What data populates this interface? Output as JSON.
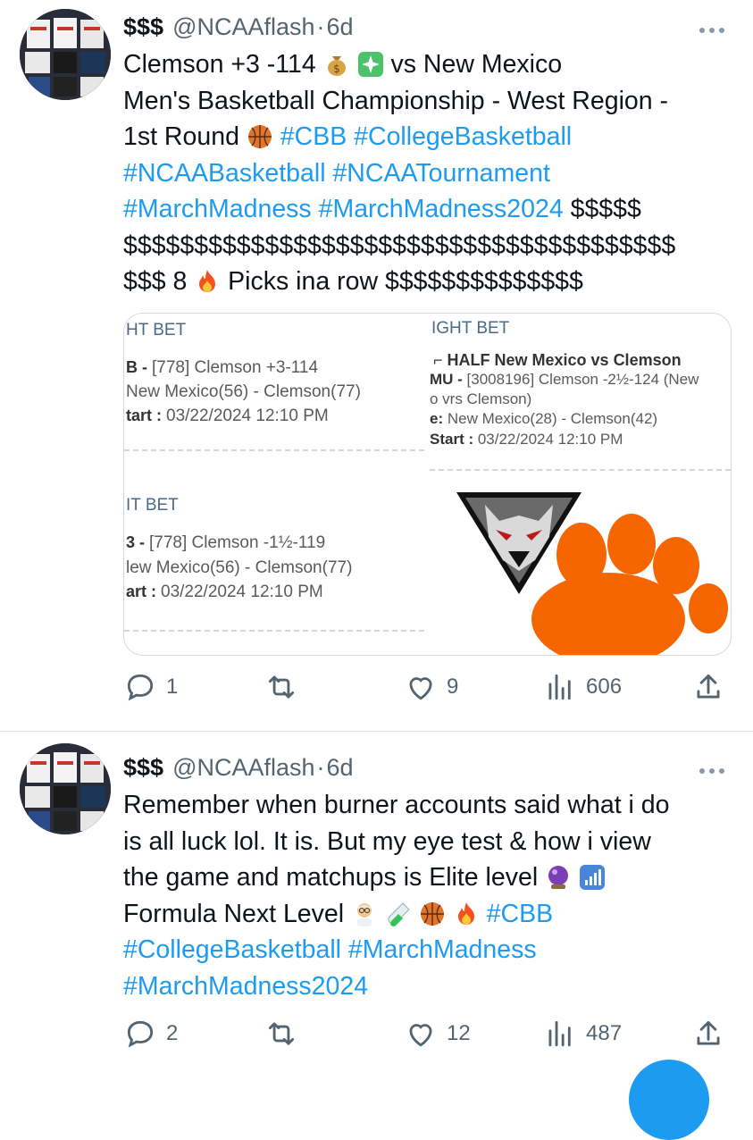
{
  "tweets": [
    {
      "name": "$$$",
      "handle": "@NCAAflash",
      "separator": "·",
      "time": "6d",
      "lines": [
        [
          {
            "t": "Clemson +3 -114 "
          },
          {
            "e": "money-bag"
          },
          {
            "t": " "
          },
          {
            "e": "sparkles"
          },
          {
            "t": " vs New Mexico"
          }
        ],
        [
          {
            "t": "Men's Basketball Championship - West Region -"
          }
        ],
        [
          {
            "t": "1st Round "
          },
          {
            "e": "basketball"
          },
          {
            "t": " "
          },
          {
            "h": "#CBB"
          },
          {
            "t": " "
          },
          {
            "h": "#CollegeBasketball"
          }
        ],
        [
          {
            "h": "#NCAABasketball"
          },
          {
            "t": " "
          },
          {
            "h": "#NCAATournament"
          }
        ],
        [
          {
            "h": "#MarchMadness"
          },
          {
            "t": " "
          },
          {
            "h": "#MarchMadness2024"
          },
          {
            "t": " $$$$$"
          }
        ],
        [
          {
            "t": "$$$$$$$$$$$$$$$$$$$$$$$$$$$$$$$$$$$$$$$"
          }
        ],
        [
          {
            "t": "$$$ 8 "
          },
          {
            "e": "fire"
          },
          {
            "t": " Picks ina row $$$$$$$$$$$$$$"
          }
        ]
      ],
      "media": {
        "slip1": {
          "header": "HT BET",
          "r1_label": "B - ",
          "r1_text": " [778] Clemson +3-114",
          "r2": "New Mexico(56) - Clemson(77)",
          "r3_label": "tart : ",
          "r3_text": "03/22/2024 12:10 PM"
        },
        "slip2": {
          "header": "IGHT BET",
          "title": "HALF New Mexico vs Clemson",
          "r1_label": "MU - ",
          "r1_text": " [3008196] Clemson -2½-124 (New",
          "r1b": "o vrs Clemson)",
          "r2_label": "e: ",
          "r2_text": " New Mexico(28) - Clemson(42)",
          "r3_label": "Start : ",
          "r3_text": "03/22/2024 12:10 PM"
        },
        "slip3": {
          "header": "IT BET",
          "r1_label": "3 - ",
          "r1_text": " [778] Clemson -1½-119",
          "r2": "lew Mexico(56) - Clemson(77)",
          "r3_label": "art : ",
          "r3_text": "03/22/2024 12:10 PM"
        }
      },
      "actions": {
        "replies": "1",
        "retweets": "",
        "likes": "9",
        "views": "606"
      }
    },
    {
      "name": "$$$",
      "handle": "@NCAAflash",
      "separator": "·",
      "time": "6d",
      "lines": [
        [
          {
            "t": "Remember when burner accounts said what i do"
          }
        ],
        [
          {
            "t": "is all luck lol. It is. But my eye test & how i view"
          }
        ],
        [
          {
            "t": "the game and matchups is Elite level "
          },
          {
            "e": "crystal-ball"
          },
          {
            "t": " "
          },
          {
            "e": "signal-bars"
          }
        ],
        [
          {
            "t": "Formula Next Level "
          },
          {
            "e": "scientist"
          },
          {
            "t": " "
          },
          {
            "e": "test-tube"
          },
          {
            "t": " "
          },
          {
            "e": "basketball"
          },
          {
            "t": " "
          },
          {
            "e": "fire"
          },
          {
            "t": " "
          },
          {
            "h": "#CBB"
          }
        ],
        [
          {
            "h": "#CollegeBasketball"
          },
          {
            "t": " "
          },
          {
            "h": "#MarchMadness"
          }
        ],
        [
          {
            "h": "#MarchMadness2024"
          }
        ]
      ],
      "actions": {
        "replies": "2",
        "retweets": "",
        "likes": "12",
        "views": "487"
      }
    }
  ],
  "colors": {
    "link": "#1d9bf0",
    "muted": "#536471",
    "clemson_orange": "#f56600"
  }
}
